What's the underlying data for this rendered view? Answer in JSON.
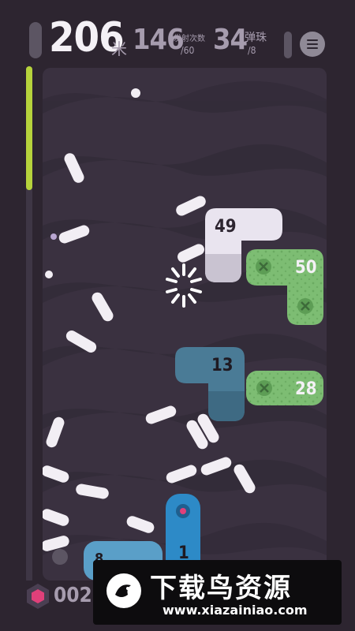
{
  "hud": {
    "distance": "206",
    "distance_unit": "米",
    "shots_value": "146",
    "shots_label": "发射次数",
    "shots_max": "/60",
    "balls_value": "34",
    "balls_label": "弹珠",
    "balls_max": "/8",
    "menu_icon": "menu-icon"
  },
  "meter": {
    "level": 0.24,
    "color": "#b6d33c"
  },
  "blocks": [
    {
      "id": "block-49",
      "label": "49",
      "color": "#e9e4ef"
    },
    {
      "id": "block-50",
      "label": "50",
      "color": "#7dbd73"
    },
    {
      "id": "block-13",
      "label": "13",
      "color": "#4a7b96"
    },
    {
      "id": "block-28",
      "label": "28",
      "color": "#7dbd73"
    },
    {
      "id": "block-1",
      "label": "1",
      "color": "#2d8ac7"
    },
    {
      "id": "block-8",
      "label": "8",
      "color": "#5a9fc8"
    }
  ],
  "bottom": {
    "counter": "002",
    "gem_icon": "hexagon-gem-icon"
  },
  "watermark": {
    "title": "下载鸟资源",
    "url": "www.xiazainiao.com"
  }
}
